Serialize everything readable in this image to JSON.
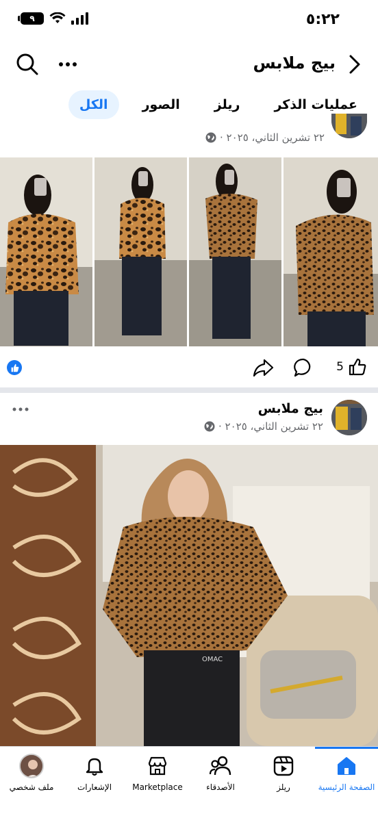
{
  "status": {
    "time": "٥:٢٢",
    "battery": "٩"
  },
  "header": {
    "page_name": "بيج ملابس"
  },
  "tabs": [
    {
      "label": "الكل",
      "active": true
    },
    {
      "label": "الصور",
      "active": false
    },
    {
      "label": "ريلز",
      "active": false
    },
    {
      "label": "عمليات الذكر",
      "active": false
    }
  ],
  "post1": {
    "date": "٢٢ تشرين الثاني، ٢٠٢٥ ·",
    "likes": "5"
  },
  "post2": {
    "author": "بيج ملابس",
    "date": "٢٢ تشرين الثاني، ٢٠٢٥ ·"
  },
  "bottom_nav": {
    "home": "الصفحة الرئيسية",
    "reels": "ريلز",
    "friends": "الأصدقاء",
    "marketplace": "Marketplace",
    "notifications": "الإشعارات",
    "profile": "ملف شخصي"
  },
  "colors": {
    "accent": "#1877f2",
    "divider": "#e4e6eb",
    "leopard": "#b77a3a"
  }
}
